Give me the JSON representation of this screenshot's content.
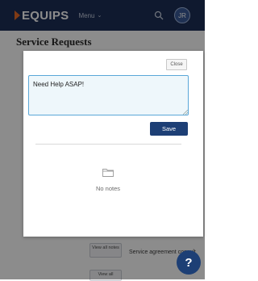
{
  "header": {
    "logo_text": "EQUIPS",
    "menu_label": "Menu",
    "avatar_initials": "JR"
  },
  "page": {
    "title": "Service Requests"
  },
  "background_rows": [
    {
      "button_label": "View all notes",
      "text": "Service agreement consult"
    },
    {
      "button_label": "View all"
    }
  ],
  "modal": {
    "close_label": "Close",
    "note_value": "Need Help ASAP!",
    "save_label": "Save",
    "empty_state_text": "No notes"
  },
  "help_button_label": "?",
  "colors": {
    "nav_bg": "#1d2f57",
    "primary": "#1d3f75",
    "input_focus": "#5aa7d8",
    "logo_accent": "#e86a27"
  }
}
